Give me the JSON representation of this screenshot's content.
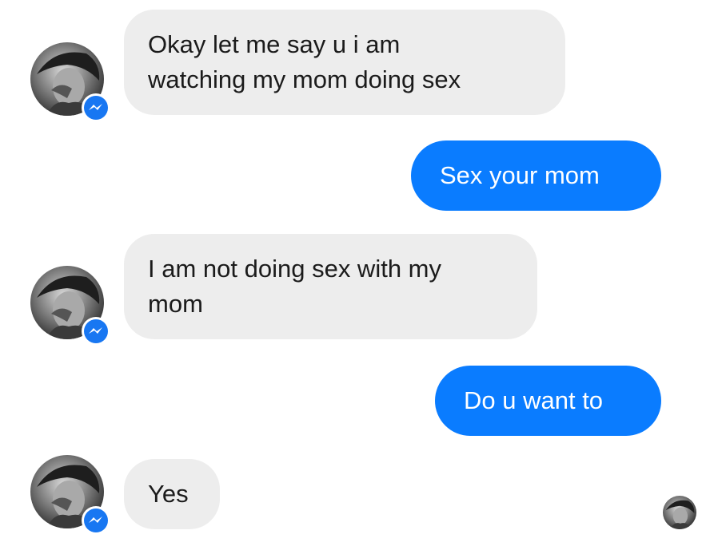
{
  "colors": {
    "incoming_bubble": "#ededed",
    "outgoing_bubble": "#0a7cff",
    "messenger_badge": "#1877f2"
  },
  "messages": [
    {
      "side": "incoming",
      "lines": [
        "Okay let me say u i am",
        "watching my mom doing sex"
      ]
    },
    {
      "side": "outgoing",
      "lines": [
        "Sex your mom"
      ]
    },
    {
      "side": "incoming",
      "lines": [
        "I am not doing sex with my",
        "mom"
      ]
    },
    {
      "side": "outgoing",
      "lines": [
        "Do u want to"
      ]
    },
    {
      "side": "incoming",
      "lines": [
        "Yes"
      ]
    }
  ],
  "icons": {
    "sender_avatar": "avatar-photo",
    "sender_badge": "messenger-icon",
    "read_receipt": "seen-avatar-icon"
  }
}
